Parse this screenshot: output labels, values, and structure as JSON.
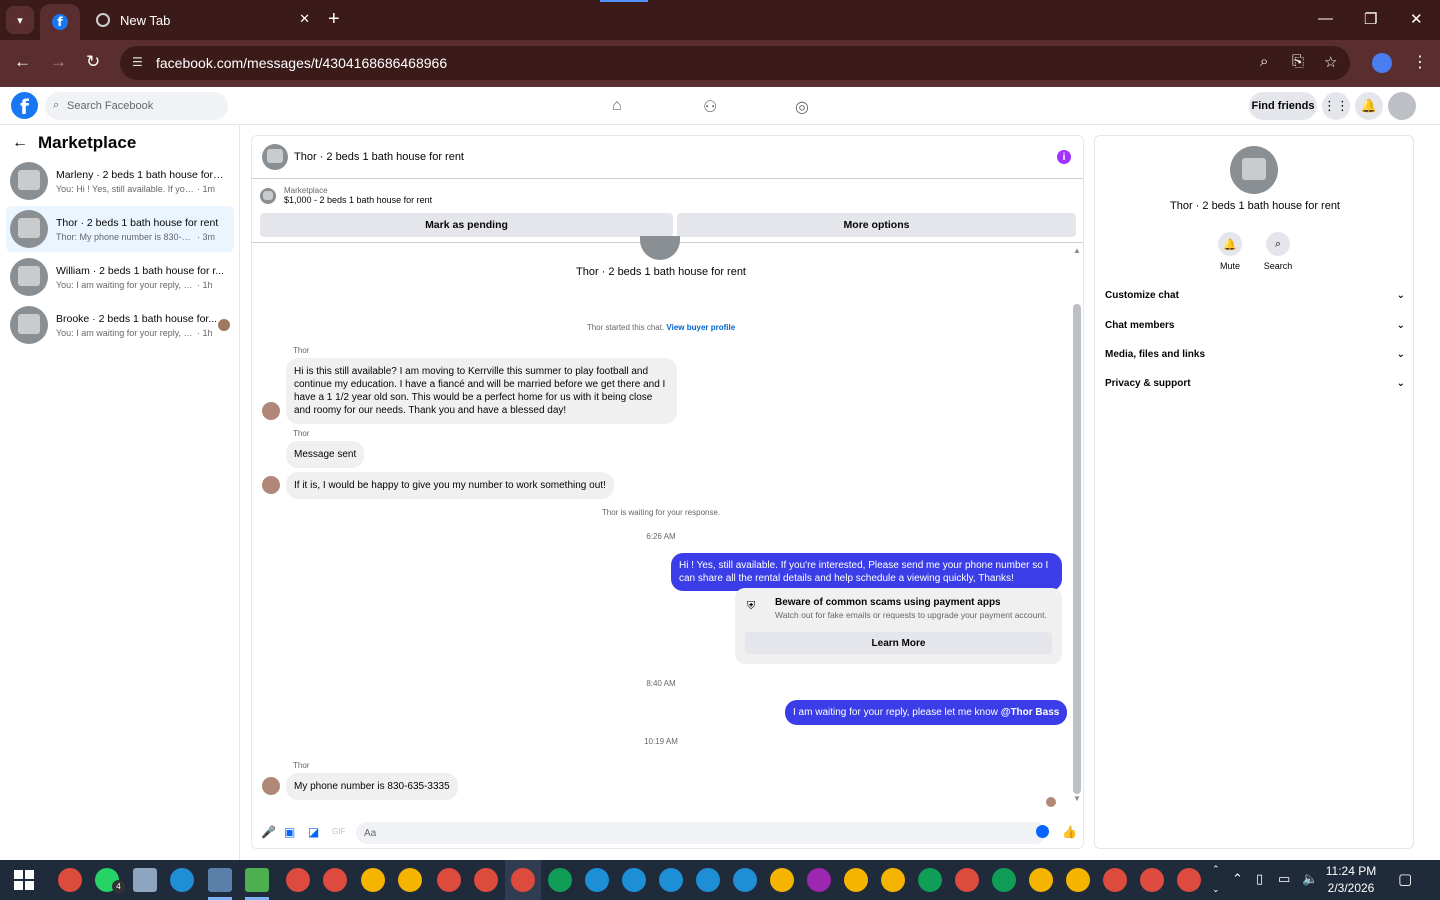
{
  "browser": {
    "tab_new_label": "New Tab",
    "url": "facebook.com/messages/t/4304168686468966"
  },
  "fb": {
    "logo": "f",
    "search_placeholder": "Search Facebook",
    "find_friends": "Find friends"
  },
  "sidebar": {
    "title": "Marketplace",
    "conversations": [
      {
        "name": "Marleny · 2 beds 1 bath house for r...",
        "preview": "You: Hi ! Yes, still available. If you're in...",
        "time": "· 1m"
      },
      {
        "name": "Thor · 2 beds 1 bath house for rent",
        "preview": "Thor: My phone number is 830-635-...",
        "time": "· 3m"
      },
      {
        "name": "William · 2 beds 1 bath house for r...",
        "preview": "You: I am waiting for your reply, pleas...",
        "time": "· 1h"
      },
      {
        "name": "Brooke · 2 beds 1 bath house for...",
        "preview": "You: I am waiting for your reply, ple...",
        "time": "· 1h"
      }
    ]
  },
  "chat": {
    "title": "Thor · 2 beds 1 bath house for rent",
    "marketplace_label": "Marketplace",
    "listing": "$1,000 - 2 beds 1 bath house for rent",
    "mark_pending": "Mark as pending",
    "more_options": "More options",
    "profile_name": "Thor · 2 beds 1 bath house for rent",
    "started": "Thor started this chat.",
    "view_buyer": "View buyer profile",
    "sender": "Thor",
    "msg1": "Hi is this still available? I am moving to Kerrville this summer to play football and continue my education. I have a fiancé and will be married before we get there and I have a 1 1/2 year old son. This would be a perfect home for us with it being close and roomy for our needs. Thank you and have a blessed day!",
    "msg2": "Message sent",
    "msg3": "If it is, I would be happy to give you my number to work something out!",
    "waiting": "Thor is waiting for your response.",
    "time1": "6:26 AM",
    "out1": "Hi ! Yes, still available. If you're interested, Please send me your phone number so I can share all the rental details and help schedule a viewing quickly, Thanks!",
    "scam_title": "Beware of common scams using payment apps",
    "scam_desc": "Watch out for fake emails or requests to upgrade your payment account.",
    "learn_more": "Learn More",
    "time2": "8:40 AM",
    "out2_text": "I am waiting for your reply, please let me know ",
    "out2_mention": "@Thor Bass",
    "time3": "10:19 AM",
    "msg4": "My phone number is 830-635-3335",
    "composer_placeholder": "Aa"
  },
  "details": {
    "name": "Thor · 2 beds 1 bath house for rent",
    "mute": "Mute",
    "search": "Search",
    "sections": [
      "Customize chat",
      "Chat members",
      "Media, files and links",
      "Privacy & support"
    ]
  },
  "taskbar": {
    "time": "11:24 PM",
    "date": "2/3/2026",
    "whatsapp_badge": "4"
  }
}
